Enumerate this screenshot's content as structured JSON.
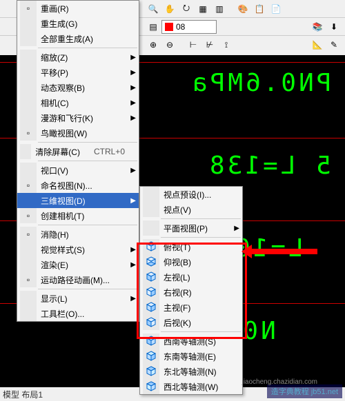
{
  "toolbar": {
    "layer_name": "08"
  },
  "canvas": {
    "text1": "PN0.6MPa",
    "text2": "5 L=138",
    "text3": "L=10",
    "text4": "N0.6"
  },
  "status": {
    "tab": "模型 布局1"
  },
  "main_menu": {
    "items": [
      {
        "label": "重画(R)",
        "icon": "redraw"
      },
      {
        "label": "重生成(G)"
      },
      {
        "label": "全部重生成(A)"
      }
    ],
    "items2": [
      {
        "label": "缩放(Z)",
        "sub": true
      },
      {
        "label": "平移(P)",
        "sub": true
      },
      {
        "label": "动态观察(B)",
        "sub": true
      },
      {
        "label": "相机(C)",
        "sub": true
      },
      {
        "label": "漫游和飞行(K)",
        "sub": true
      },
      {
        "label": "鸟瞰视图(W)",
        "icon": "aerial"
      }
    ],
    "items3": [
      {
        "label": "清除屏幕(C)",
        "shortcut": "CTRL+0"
      }
    ],
    "items4": [
      {
        "label": "视口(V)",
        "sub": true
      },
      {
        "label": "命名视图(N)...",
        "icon": "named-view"
      },
      {
        "label": "三维视图(D)",
        "sub": true,
        "hl": true
      },
      {
        "label": "创建相机(T)",
        "icon": "camera"
      }
    ],
    "items5": [
      {
        "label": "消隐(H)",
        "icon": "hide"
      },
      {
        "label": "视觉样式(S)",
        "sub": true
      },
      {
        "label": "渲染(E)",
        "sub": true
      },
      {
        "label": "运动路径动画(M)...",
        "icon": "motion"
      }
    ],
    "items6": [
      {
        "label": "显示(L)",
        "sub": true
      },
      {
        "label": "工具栏(O)..."
      }
    ]
  },
  "sub_menu": {
    "items1": [
      {
        "label": "视点预设(I)..."
      },
      {
        "label": "视点(V)"
      }
    ],
    "items2": [
      {
        "label": "平面视图(P)",
        "sub": true
      }
    ],
    "items3": [
      {
        "label": "俯视(T)",
        "icon": "cube-top"
      },
      {
        "label": "仰视(B)",
        "icon": "cube-bottom"
      },
      {
        "label": "左视(L)",
        "icon": "cube-left"
      },
      {
        "label": "右视(R)",
        "icon": "cube-right"
      },
      {
        "label": "主视(F)",
        "icon": "cube-front"
      },
      {
        "label": "后视(K)",
        "icon": "cube-back"
      }
    ],
    "items4": [
      {
        "label": "西南等轴测(S)",
        "icon": "iso-sw"
      },
      {
        "label": "东南等轴测(E)",
        "icon": "iso-se"
      },
      {
        "label": "东北等轴测(N)",
        "icon": "iso-ne"
      },
      {
        "label": "西北等轴测(W)",
        "icon": "iso-nw"
      }
    ]
  },
  "watermark": {
    "text1": "造字典教程 jb51.net",
    "text2": "jiaocheng.chazidian.com"
  }
}
